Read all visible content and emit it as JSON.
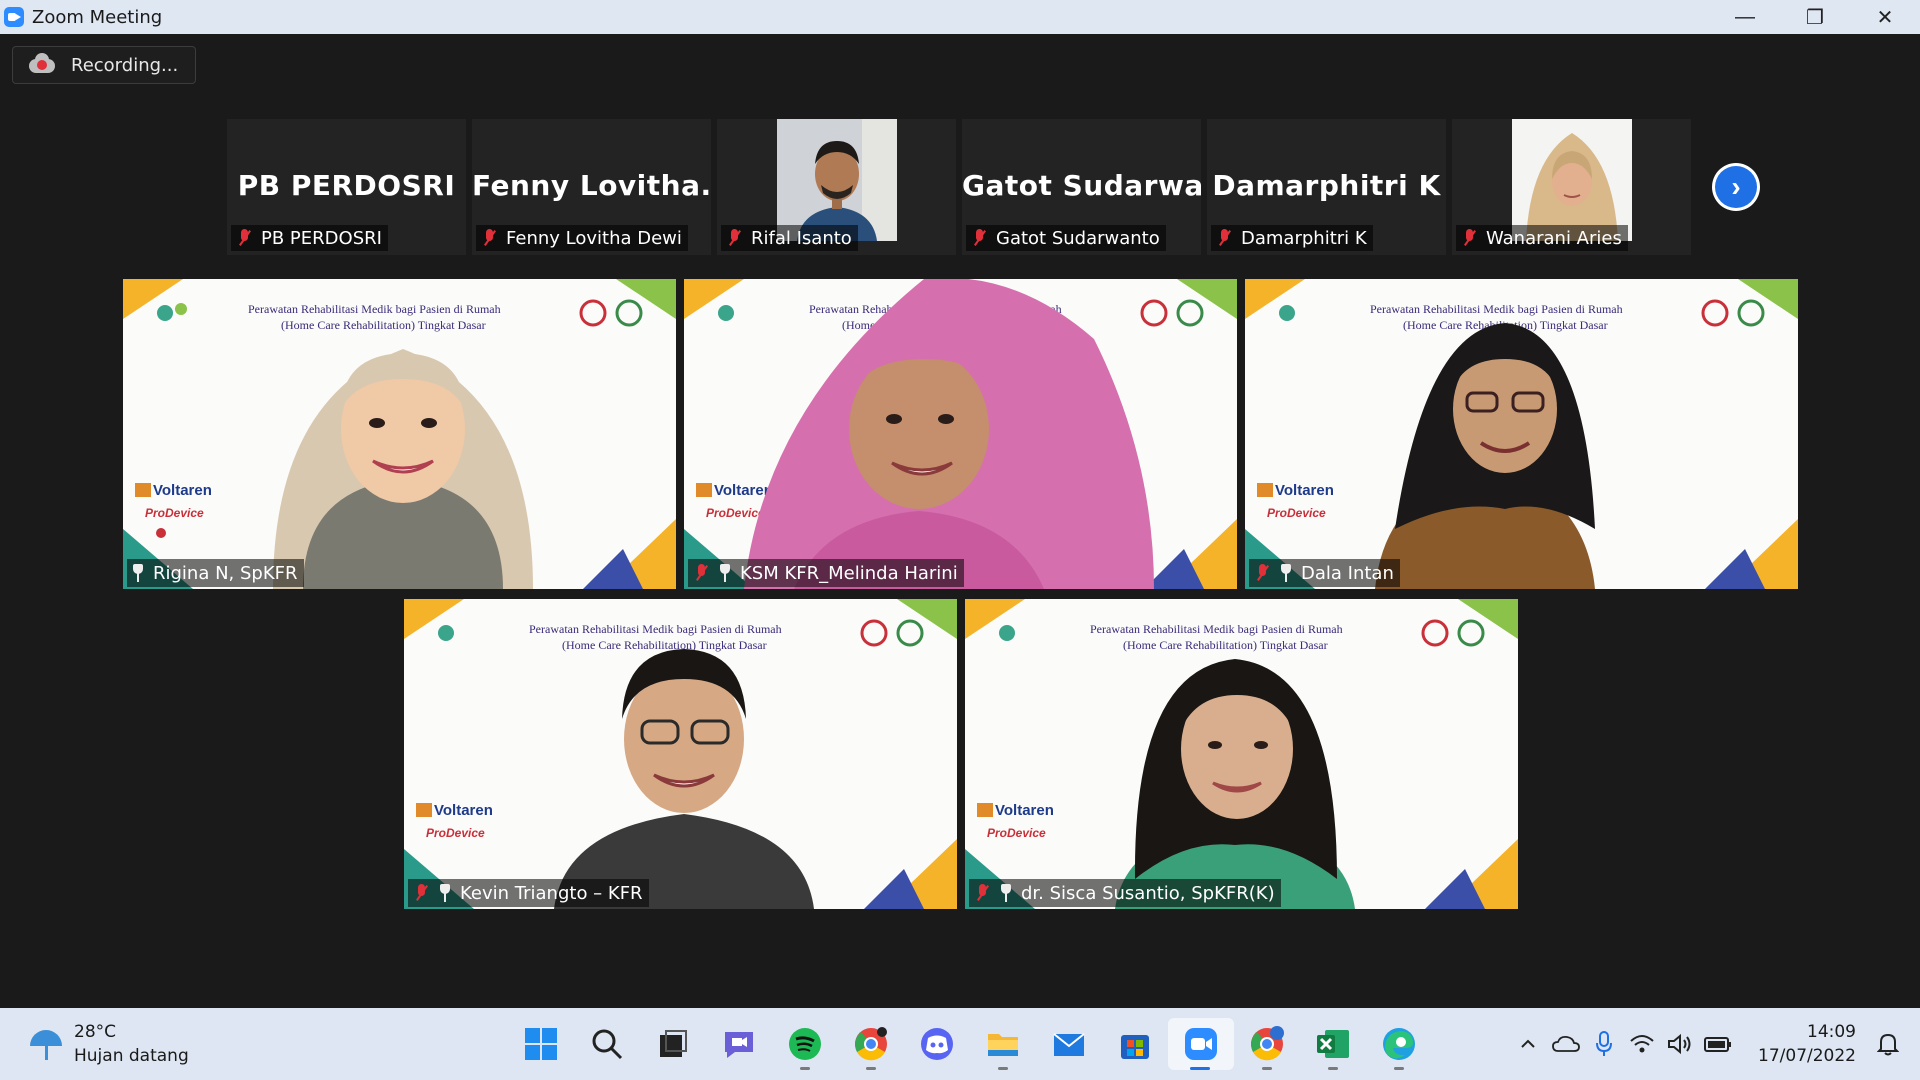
{
  "window": {
    "title": "Zoom Meeting",
    "controls": {
      "minimize": "—",
      "restore": "❐",
      "close": "✕"
    }
  },
  "recording": {
    "label": "Recording..."
  },
  "strip": [
    {
      "display_name": "PB PERDOSRI",
      "name": "PB PERDOSRI",
      "video": false
    },
    {
      "display_name": "Fenny  Lovitha...",
      "name": "Fenny Lovitha Dewi",
      "video": false
    },
    {
      "display_name": "",
      "name": "Rifal Isanto",
      "video": true
    },
    {
      "display_name": "Gatot  Sudarwa...",
      "name": "Gatot Sudarwanto",
      "video": false
    },
    {
      "display_name": "Damarphitri K",
      "name": "Damarphitri K",
      "video": false
    },
    {
      "display_name": "",
      "name": "Wanarani Aries",
      "video": true
    }
  ],
  "strip_next_icon": "chevron-right",
  "slide": {
    "line1": "Perawatan Rehabilitasi Medik bagi Pasien di Rumah",
    "line2": "(Home Care Rehabilitation) Tingkat Dasar",
    "sponsor1": "Voltaren",
    "sponsor2": "ProDevice"
  },
  "gallery": [
    {
      "name": "Rigina N, SpKFR",
      "muted": false
    },
    {
      "name": "KSM KFR_Melinda Harini",
      "muted": true
    },
    {
      "name": "Dala Intan",
      "muted": true
    },
    {
      "name": "Kevin Triangto – KFR",
      "muted": true
    },
    {
      "name": "dr. Sisca Susantio, SpKFR(K)",
      "muted": true
    }
  ],
  "taskbar": {
    "weather": {
      "temp": "28°C",
      "desc": "Hujan datang"
    },
    "apps": [
      "windows-start",
      "search",
      "task-view",
      "teams-chat",
      "spotify",
      "chrome",
      "discord",
      "file-explorer",
      "mail",
      "microsoft-store",
      "zoom",
      "chrome-profile",
      "excel",
      "edge"
    ],
    "clock": {
      "time": "14:09",
      "date": "17/07/2022"
    }
  },
  "colors": {
    "accent": "#1f6fe5",
    "muted": "#e0303a",
    "zoom": "#2d8cff"
  }
}
